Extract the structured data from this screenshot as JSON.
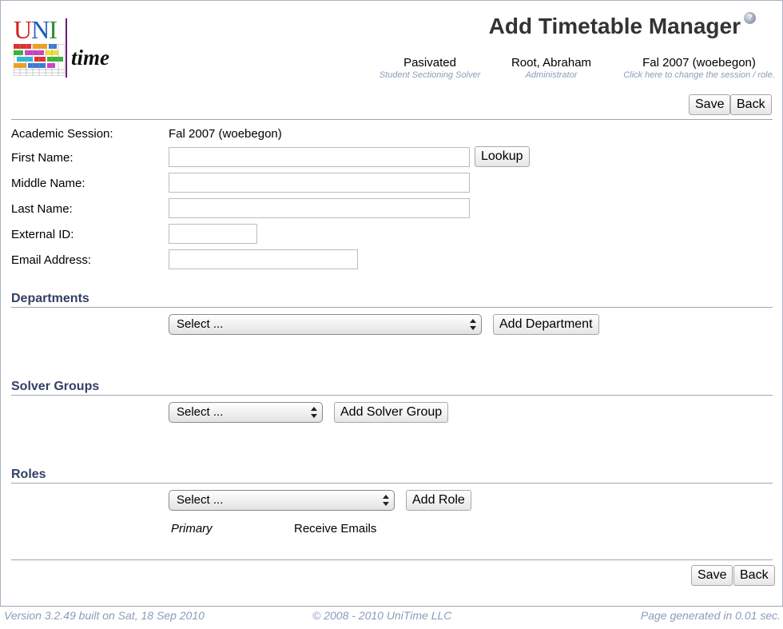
{
  "logo": {
    "uni_u": "U",
    "uni_n": "N",
    "uni_i": "I",
    "time": "time"
  },
  "page_title": "Add Timetable Manager",
  "help_icon_glyph": "?",
  "header_info": [
    {
      "main": "Pasivated",
      "sub": "Student Sectioning Solver"
    },
    {
      "main": "Root, Abraham",
      "sub": "Administrator"
    },
    {
      "main": "Fal 2007 (woebegon)",
      "sub": "Click here to change the session / role."
    }
  ],
  "buttons": {
    "save": "Save",
    "back": "Back",
    "lookup": "Lookup",
    "add_department": "Add Department",
    "add_solver_group": "Add Solver Group",
    "add_role": "Add Role"
  },
  "form": {
    "academic_session_label": "Academic Session:",
    "academic_session_value": "Fal 2007 (woebegon)",
    "first_name_label": "First Name:",
    "first_name_value": "",
    "middle_name_label": "Middle Name:",
    "middle_name_value": "",
    "last_name_label": "Last Name:",
    "last_name_value": "",
    "external_id_label": "External ID:",
    "external_id_value": "",
    "email_label": "Email Address:",
    "email_value": ""
  },
  "sections": {
    "departments": {
      "title": "Departments",
      "select_value": "Select ..."
    },
    "solver_groups": {
      "title": "Solver Groups",
      "select_value": "Select ..."
    },
    "roles": {
      "title": "Roles",
      "select_value": "Select ...",
      "col_primary": "Primary",
      "col_receive_emails": "Receive Emails"
    }
  },
  "footer": {
    "version": "Version 3.2.49 built on Sat, 18 Sep 2010",
    "copyright": "© 2008 - 2010 UniTime LLC",
    "generated": "Page generated in 0.01 sec."
  },
  "colors": {
    "section_title": "#333f66",
    "sub_text": "#8b9cba",
    "rule": "#9aa6b5"
  }
}
